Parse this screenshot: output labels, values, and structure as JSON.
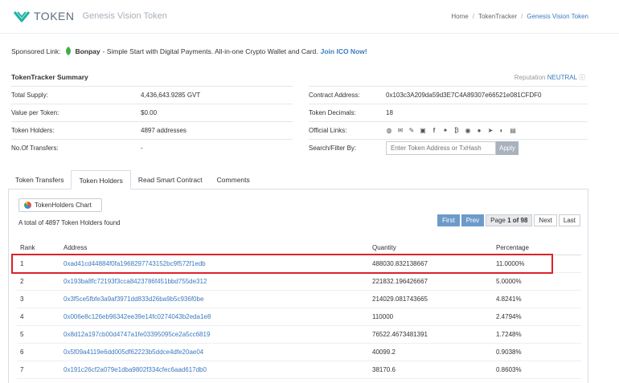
{
  "header": {
    "logo_text": "TOKEN",
    "token_name": "Genesis Vision Token",
    "breadcrumb": [
      "Home",
      "TokenTracker",
      "Genesis Vision Token"
    ]
  },
  "sponsored": {
    "label": "Sponsored Link:",
    "brand": "Bonpay",
    "text": "- Simple Start with Digital Payments. All-in-one Crypto Wallet and Card.",
    "link": "Join ICO Now!"
  },
  "summary": {
    "title": "TokenTracker Summary",
    "reputation_label": "Reputation",
    "reputation_value": "NEUTRAL",
    "left": [
      {
        "k": "Total Supply:",
        "v": "4,436,643.9285 GVT"
      },
      {
        "k": "Value per Token:",
        "v": "$0.00"
      },
      {
        "k": "Token Holders:",
        "v": "4897 addresses"
      },
      {
        "k": "No.Of Transfers:",
        "v": "-"
      }
    ],
    "contract_label": "Contract Address:",
    "contract_value": "0x103c3A209da59d3E7C4A89307e66521e081CFDF0",
    "decimals_label": "Token Decimals:",
    "decimals_value": "18",
    "links_label": "Official Links:",
    "search_label": "Search/Filter By:",
    "search_placeholder": "Enter Token Address or TxHash",
    "apply_label": "Apply"
  },
  "tabs": [
    "Token Transfers",
    "Token Holders",
    "Read Smart Contract",
    "Comments"
  ],
  "holders": {
    "chart_button": "TokenHolders Chart",
    "total_text": "A total of 4897 Token Holders found",
    "pager": {
      "first": "First",
      "prev": "Prev",
      "page_prefix": "Page",
      "page_bold": "1 of 98",
      "next": "Next",
      "last": "Last"
    },
    "columns": [
      "Rank",
      "Address",
      "Quantity",
      "Percentage"
    ],
    "rows": [
      {
        "rank": "1",
        "address": "0xad41cd44884f0fa1968297743152bc9f572f1edb",
        "qty": "488030.832138667",
        "pct": "11.0000%"
      },
      {
        "rank": "2",
        "address": "0x193ba8fc72193f3cca8423786f451bbd755de312",
        "qty": "221832.196426667",
        "pct": "5.0000%"
      },
      {
        "rank": "3",
        "address": "0x3f5ce5fbfe3a9af3971dd833d26ba9b5c936f0be",
        "qty": "214029.081743665",
        "pct": "4.8241%"
      },
      {
        "rank": "4",
        "address": "0x006e8c126eb96342ee39e14fc0274043b2eda1e8",
        "qty": "110000",
        "pct": "2.4794%"
      },
      {
        "rank": "5",
        "address": "0x8d12a197cb00d4747a1fe03395095ce2a5cc6819",
        "qty": "76522.4673481391",
        "pct": "1.7248%"
      },
      {
        "rank": "6",
        "address": "0x5f09a4119e6dd005df62223b5ddce4dfe20ae04",
        "qty": "40099.2",
        "pct": "0.9038%"
      },
      {
        "rank": "7",
        "address": "0x191c26cf2a079e1dba9802f334cfec6aad617db0",
        "qty": "38170.6",
        "pct": "0.8603%"
      }
    ]
  },
  "colors": {
    "accent": "#3b7bbf",
    "highlight": "#d9232a",
    "logo": "#1eb2a6"
  },
  "icons": [
    "globe-icon",
    "email-icon",
    "edit-icon",
    "document-icon",
    "facebook-icon",
    "twitter-icon",
    "bitcoin-icon",
    "reddit-icon",
    "github-icon",
    "telegram-icon",
    "wechat-icon",
    "whitepaper-icon"
  ]
}
